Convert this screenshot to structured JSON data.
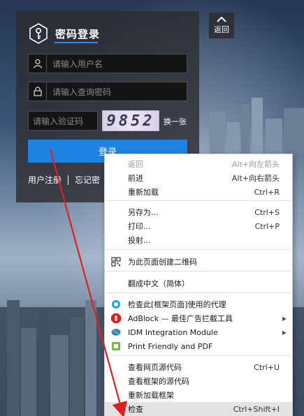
{
  "login": {
    "title": "密码登录",
    "username_placeholder": "请输入用户名",
    "password_placeholder": "请输入查询密码",
    "captcha_placeholder": "请输入验证码",
    "captcha_code": "9852",
    "captcha_refresh": "换一张",
    "login_button": "登录",
    "register_link": "用户注册",
    "forgot_link": "忘记密"
  },
  "back_button": {
    "label": "返回"
  },
  "context_menu": {
    "items": [
      {
        "label": "返回",
        "shortcut": "Alt+向左箭头",
        "disabled": true
      },
      {
        "label": "前进",
        "shortcut": "Alt+向右箭头"
      },
      {
        "label": "重新加载",
        "shortcut": "Ctrl+R"
      },
      {
        "label": "另存为...",
        "shortcut": "Ctrl+S"
      },
      {
        "label": "打印...",
        "shortcut": "Ctrl+P"
      },
      {
        "label": "投射..."
      },
      {
        "label": "为此页面创建二维码",
        "icon": "qr-code-icon"
      },
      {
        "label": "翻成中文（简体）"
      },
      {
        "label": "检查此[框架页面]使用的代理",
        "icon": "proxy-extension-icon"
      },
      {
        "label": "AdBlock — 最佳广告拦截工具",
        "icon": "adblock-icon",
        "submenu": true
      },
      {
        "label": "IDM Integration Module",
        "icon": "idm-icon",
        "submenu": true
      },
      {
        "label": "Print Friendly and PDF",
        "icon": "print-friendly-icon"
      },
      {
        "label": "查看网页源代码",
        "shortcut": "Ctrl+U"
      },
      {
        "label": "查看框架的源代码"
      },
      {
        "label": "重新加载框架"
      },
      {
        "label": "检查",
        "shortcut": "Ctrl+Shift+I",
        "highlighted": true
      }
    ]
  },
  "colors": {
    "accent_blue": "#1e83e3",
    "annotation_arrow": "#e0201c",
    "menu_highlight": "#e3e3e3"
  }
}
